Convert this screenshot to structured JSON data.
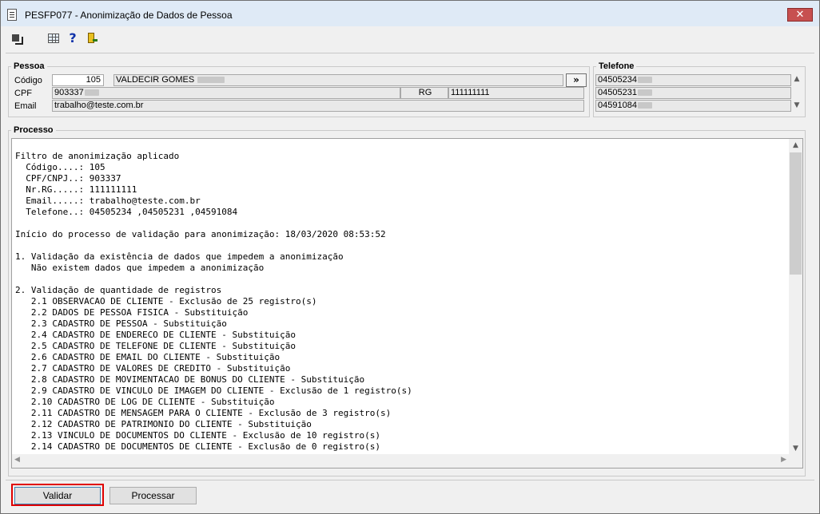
{
  "window": {
    "title": "PESFP077 - Anonimização de Dados de Pessoa",
    "close_label": "✕"
  },
  "toolbar": {
    "help_label": "?"
  },
  "pessoa": {
    "legend": "Pessoa",
    "codigo_label": "Código",
    "codigo_value": "105",
    "nome_value": "VALDECIR GOMES",
    "more_label": "»",
    "cpf_label": "CPF",
    "cpf_value": "903337",
    "rg_label": "RG",
    "rg_value": "111111111",
    "email_label": "Email",
    "email_value": "trabalho@teste.com.br"
  },
  "telefone": {
    "legend": "Telefone",
    "items": [
      "04505234",
      "04505231",
      "04591084"
    ]
  },
  "processo": {
    "legend": "Processo",
    "lines": [
      "Filtro de anonimização aplicado",
      "  Código....: 105",
      "  CPF/CNPJ..: 903337",
      "  Nr.RG.....: 111111111",
      "  Email.....: trabalho@teste.com.br",
      "  Telefone..: 04505234 ,04505231 ,04591084",
      "",
      "Início do processo de validação para anonimização: 18/03/2020 08:53:52",
      "",
      "1. Validação da existência de dados que impedem a anonimização",
      "   Não existem dados que impedem a anonimização",
      "",
      "2. Validação de quantidade de registros",
      "   2.1 OBSERVACAO DE CLIENTE - Exclusão de 25 registro(s)",
      "   2.2 DADOS DE PESSOA FISICA - Substituição",
      "   2.3 CADASTRO DE PESSOA - Substituição",
      "   2.4 CADASTRO DE ENDERECO DE CLIENTE - Substituição",
      "   2.5 CADASTRO DE TELEFONE DE CLIENTE - Substituição",
      "   2.6 CADASTRO DE EMAIL DO CLIENTE - Substituição",
      "   2.7 CADASTRO DE VALORES DE CREDITO - Substituição",
      "   2.8 CADASTRO DE MOVIMENTACAO DE BONUS DO CLIENTE - Substituição",
      "   2.9 CADASTRO DE VINCULO DE IMAGEM DO CLIENTE - Exclusão de 1 registro(s)",
      "   2.10 CADASTRO DE LOG DE CLIENTE - Substituição",
      "   2.11 CADASTRO DE MENSAGEM PARA O CLIENTE - Exclusão de 3 registro(s)",
      "   2.12 CADASTRO DE PATRIMONIO DO CLIENTE - Substituição",
      "   2.13 VINCULO DE DOCUMENTOS DO CLIENTE - Exclusão de 10 registro(s)",
      "   2.14 CADASTRO DE DOCUMENTOS DE CLIENTE - Exclusão de 0 registro(s)"
    ]
  },
  "buttons": {
    "validar_label": "Validar",
    "processar_label": "Processar"
  }
}
